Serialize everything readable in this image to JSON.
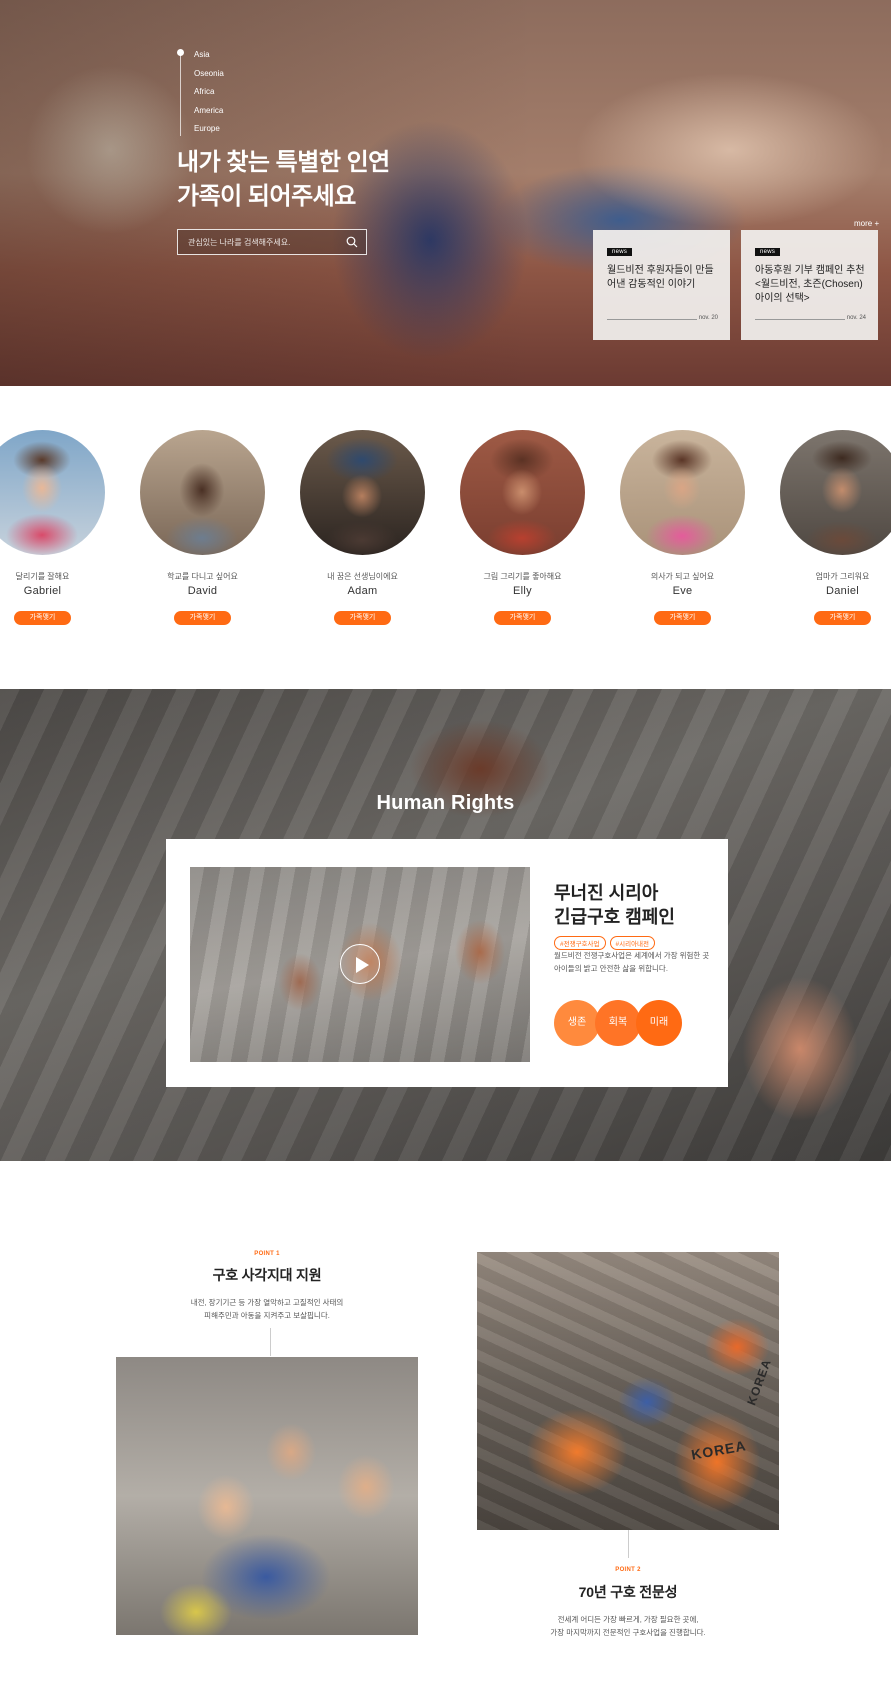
{
  "hero": {
    "regions": [
      "Asia",
      "Oseonia",
      "Africa",
      "America",
      "Europe"
    ],
    "title_line1": "내가 찾는 특별한 인연",
    "title_line2": "가족이 되어주세요",
    "search_placeholder": "관심있는 나라를 검색해주세요.",
    "more_label": "more +",
    "news": [
      {
        "badge": "news",
        "title": "월드비전 후원자들이 만들어낸 감동적인 이야기",
        "date": "nov. 20"
      },
      {
        "badge": "news",
        "title": "아동후원 기부 캠페인 추천 <월드비전, 초즌(Chosen) 아이의 선택>",
        "date": "nov. 24"
      }
    ]
  },
  "children": [
    {
      "wish": "달리기를 잘해요",
      "name": "Gabriel",
      "button": "가족맺기"
    },
    {
      "wish": "학교를 다니고 싶어요",
      "name": "David",
      "button": "가족맺기"
    },
    {
      "wish": "내 꿈은 선생님이에요",
      "name": "Adam",
      "button": "가족맺기"
    },
    {
      "wish": "그림 그리기를 좋아해요",
      "name": "Elly",
      "button": "가족맺기"
    },
    {
      "wish": "의사가 되고 싶어요",
      "name": "Eve",
      "button": "가족맺기"
    },
    {
      "wish": "엄마가 그리워요",
      "name": "Daniel",
      "button": "가족맺기"
    }
  ],
  "human_rights": {
    "title": "Human Rights",
    "heading_line1": "무너진 시리아",
    "heading_line2": "긴급구호 캠페인",
    "tags": [
      "#전쟁구호사업",
      "#시리아내전"
    ],
    "desc_line1": "월드비전 전쟁구호사업은 세계에서 가장 위험한 곳",
    "desc_line2": "아이들의 밝고 안전한 삶을 위합니다.",
    "circles": [
      "생존",
      "회복",
      "미래"
    ]
  },
  "points": [
    {
      "label": "POINT 1",
      "title": "구호 사각지대 지원",
      "desc_line1": "내전, 장기기근 등 가장 열악하고 고질적인 사태의",
      "desc_line2": "피해주민과 아동을 지켜주고 보살핍니다."
    },
    {
      "label": "POINT 2",
      "title": "70년 구호 전문성",
      "desc_line1": "전세계 어디든 가장 빠르게, 가장 필요한 곳에,",
      "desc_line2": "가장 마지막까지 전문적인 구호사업을 진행합니다."
    }
  ],
  "photo_text": {
    "vest1": "KOREA",
    "vest2": "KOREA"
  },
  "colors": {
    "accent": "#ff6a13",
    "circle1": "#ff8a3d",
    "circle2": "#ff7426",
    "circle3": "#ff6a13"
  }
}
